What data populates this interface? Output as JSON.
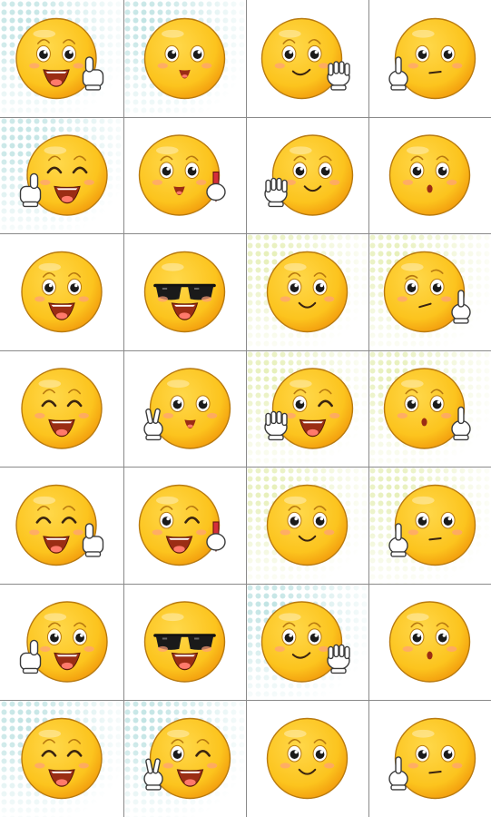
{
  "board": {
    "rows": 7,
    "columns": 4,
    "colors": {
      "face": "#fcc41e",
      "face_shade": "#f29a0c",
      "outline": "#b87a10",
      "mouth": "#9b2d14",
      "tongue": "#ff7a6b",
      "cheek": "#ff9f7a",
      "glove": "#ffffff",
      "pencil": "#d62f3a",
      "dots_blue": "#bfe3e3",
      "dots_green": "#e6efb8",
      "grid_line": "#8a8a8a"
    },
    "cards": [
      {
        "face": "laugh-smile",
        "hand": "thumbs-up",
        "hand_side": "right",
        "bg": "dots-blue"
      },
      {
        "face": "open-smile",
        "hand": "none",
        "hand_side": "",
        "bg": "dots-blue"
      },
      {
        "face": "smirk-smile",
        "hand": "wave",
        "hand_side": "right",
        "bg": "plain"
      },
      {
        "face": "neutral",
        "hand": "pointing-finger",
        "hand_side": "left",
        "bg": "plain"
      },
      {
        "face": "happy-closed-eyes",
        "hand": "thumbs-up",
        "hand_side": "left",
        "bg": "dots-blue"
      },
      {
        "face": "surprised-smile",
        "hand": "pencil",
        "hand_side": "right",
        "bg": "plain"
      },
      {
        "face": "slight-smile",
        "hand": "wave",
        "hand_side": "left",
        "bg": "plain"
      },
      {
        "face": "surprised-o",
        "hand": "none",
        "hand_side": "",
        "bg": "plain"
      },
      {
        "face": "laugh-smile",
        "hand": "none",
        "hand_side": "",
        "bg": "plain"
      },
      {
        "face": "sunglasses-grin",
        "hand": "none",
        "hand_side": "",
        "bg": "plain"
      },
      {
        "face": "smile",
        "hand": "none",
        "hand_side": "",
        "bg": "dots-green"
      },
      {
        "face": "doubtful",
        "hand": "pointing-finger",
        "hand_side": "right",
        "bg": "dots-green"
      },
      {
        "face": "happy-closed-eyes",
        "hand": "none",
        "hand_side": "",
        "bg": "plain"
      },
      {
        "face": "open-smile",
        "hand": "peace",
        "hand_side": "left",
        "bg": "plain"
      },
      {
        "face": "wink-grin",
        "hand": "wave",
        "hand_side": "left",
        "bg": "dots-green"
      },
      {
        "face": "surprised-o",
        "hand": "pointing-finger",
        "hand_side": "right",
        "bg": "dots-green"
      },
      {
        "face": "happy-closed-eyes",
        "hand": "thumbs-up",
        "hand_side": "right",
        "bg": "plain"
      },
      {
        "face": "wink-grin",
        "hand": "pencil",
        "hand_side": "right",
        "bg": "plain"
      },
      {
        "face": "smile",
        "hand": "none",
        "hand_side": "",
        "bg": "dots-green"
      },
      {
        "face": "neutral",
        "hand": "pointing-finger",
        "hand_side": "left",
        "bg": "dots-green"
      },
      {
        "face": "laugh-smile",
        "hand": "thumbs-up",
        "hand_side": "left",
        "bg": "plain"
      },
      {
        "face": "sunglasses-grin",
        "hand": "none",
        "hand_side": "",
        "bg": "plain"
      },
      {
        "face": "smirk-smile",
        "hand": "wave",
        "hand_side": "right",
        "bg": "dots-blue"
      },
      {
        "face": "surprised-o",
        "hand": "none",
        "hand_side": "",
        "bg": "plain"
      },
      {
        "face": "happy-closed-eyes",
        "hand": "none",
        "hand_side": "",
        "bg": "dots-blue"
      },
      {
        "face": "wink-grin",
        "hand": "peace",
        "hand_side": "left",
        "bg": "dots-blue"
      },
      {
        "face": "smile",
        "hand": "none",
        "hand_side": "",
        "bg": "plain"
      },
      {
        "face": "neutral",
        "hand": "pointing-finger",
        "hand_side": "left",
        "bg": "plain"
      }
    ]
  }
}
